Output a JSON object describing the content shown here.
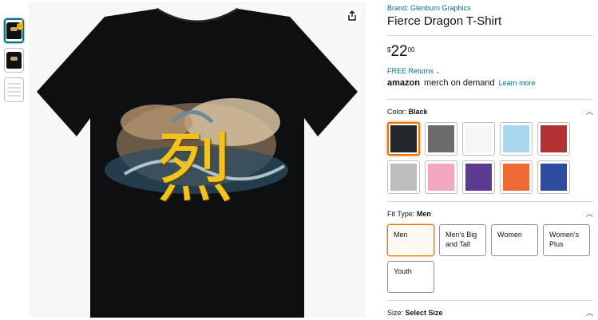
{
  "thumbnails": [
    {
      "name": "thumb-front-black",
      "selected": true
    },
    {
      "name": "thumb-front-alt",
      "selected": false
    },
    {
      "name": "thumb-size-chart",
      "selected": false
    }
  ],
  "product": {
    "brand": "Brand: Glenburn Graphics",
    "title": "Fierce Dragon T-Shirt",
    "price_symbol": "$",
    "price_whole": "22",
    "price_fraction": "00",
    "returns": "FREE Returns",
    "merch_logo": "amazon",
    "merch_text": "merch on demand",
    "learn_more": "Learn more",
    "image_text": "烈"
  },
  "color": {
    "label": "Color: ",
    "value": "Black",
    "swatches": [
      {
        "name": "Black",
        "hex": "#23272b",
        "selected": true
      },
      {
        "name": "Asphalt",
        "hex": "#6b6b6b",
        "selected": false
      },
      {
        "name": "White",
        "hex": "#f6f6f6",
        "selected": false
      },
      {
        "name": "Baby Blue",
        "hex": "#a9d7ee",
        "selected": false
      },
      {
        "name": "Cranberry",
        "hex": "#b23233",
        "selected": false
      },
      {
        "name": "Heather Grey",
        "hex": "#bdbdbd",
        "selected": false
      },
      {
        "name": "Pink",
        "hex": "#f4a7c3",
        "selected": false
      },
      {
        "name": "Purple",
        "hex": "#5c3a8f",
        "selected": false
      },
      {
        "name": "Orange",
        "hex": "#ef6a34",
        "selected": false
      },
      {
        "name": "Royal Blue",
        "hex": "#2f4ba0",
        "selected": false
      }
    ]
  },
  "fit": {
    "label": "Fit Type: ",
    "value": "Men",
    "options": [
      {
        "label": "Men",
        "selected": true
      },
      {
        "label": "Men's Big and Tall",
        "selected": false
      },
      {
        "label": "Women",
        "selected": false
      },
      {
        "label": "Women's Plus",
        "selected": false
      },
      {
        "label": "Youth",
        "selected": false
      }
    ]
  },
  "size": {
    "label": "Size: ",
    "value": "Select Size"
  },
  "icons": {
    "share": "share-icon",
    "chevron": "chevron-up-icon"
  }
}
